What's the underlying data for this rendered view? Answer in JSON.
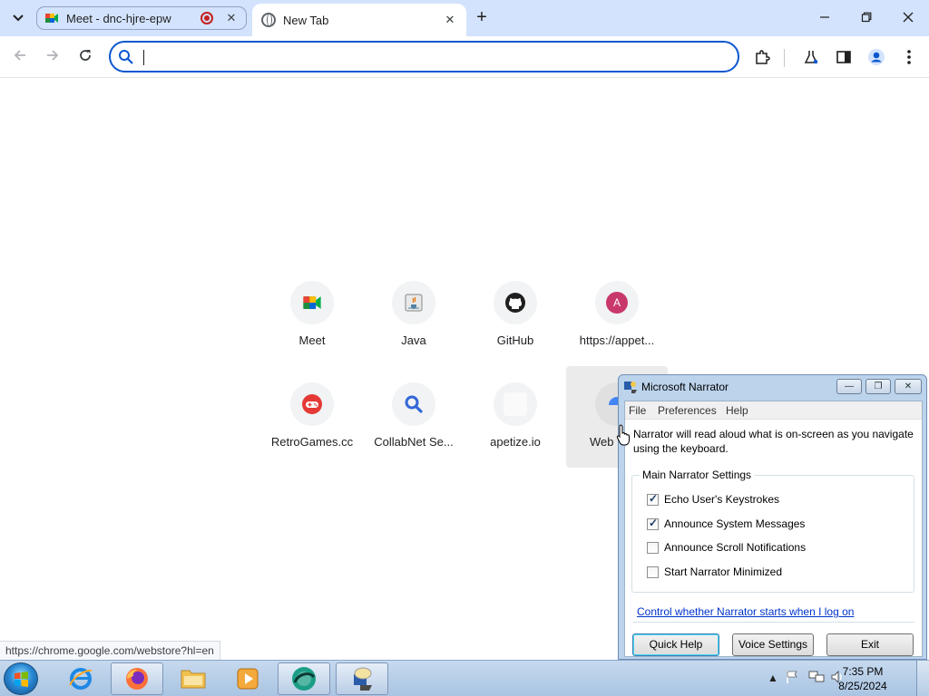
{
  "browser": {
    "tabs": [
      {
        "title": "Meet - dnc-hjre-epw",
        "icon": "google-meet-icon",
        "recording": true
      },
      {
        "title": "New Tab",
        "icon": "globe-icon",
        "active": true
      }
    ],
    "omnibox": {
      "value": "",
      "placeholder": ""
    },
    "status_url": "https://chrome.google.com/webstore?hl=en"
  },
  "shortcuts": [
    {
      "label": "Meet",
      "icon": "google-meet-icon"
    },
    {
      "label": "Java",
      "icon": "java-icon"
    },
    {
      "label": "GitHub",
      "icon": "github-icon"
    },
    {
      "label": "https://appet...",
      "icon": "letter-avatar-icon",
      "letter": "A"
    },
    {
      "label": "RetroGames.cc",
      "icon": "gamepad-icon"
    },
    {
      "label": "CollabNet Se...",
      "icon": "search-icon"
    },
    {
      "label": "apetize.io",
      "icon": "blank-icon"
    },
    {
      "label": "Web",
      "icon": "webstore-icon"
    }
  ],
  "narrator": {
    "title": "Microsoft Narrator",
    "menu": [
      "File",
      "Preferences",
      "Help"
    ],
    "description": "Narrator will read aloud what is on-screen as you navigate using the keyboard.",
    "group_title": "Main Narrator Settings",
    "options": [
      {
        "label": "Echo User's Keystrokes",
        "checked": true
      },
      {
        "label": "Announce System Messages",
        "checked": true
      },
      {
        "label": "Announce Scroll Notifications",
        "checked": false
      },
      {
        "label": "Start Narrator Minimized",
        "checked": false
      }
    ],
    "link": "Control whether Narrator starts when I log on",
    "buttons": {
      "quick_help": "Quick Help",
      "voice_settings": "Voice Settings",
      "exit": "Exit"
    }
  },
  "taskbar": {
    "apps": [
      "internet-explorer-icon",
      "firefox-icon",
      "file-explorer-icon",
      "media-player-icon",
      "browser-app-icon",
      "narrator-icon"
    ],
    "time": "7:35 PM",
    "date": "8/25/2024"
  },
  "colors": {
    "accent": "#0b57d0",
    "tabstrip": "#d3e3fd",
    "taskbar": "#b9cfe8"
  }
}
